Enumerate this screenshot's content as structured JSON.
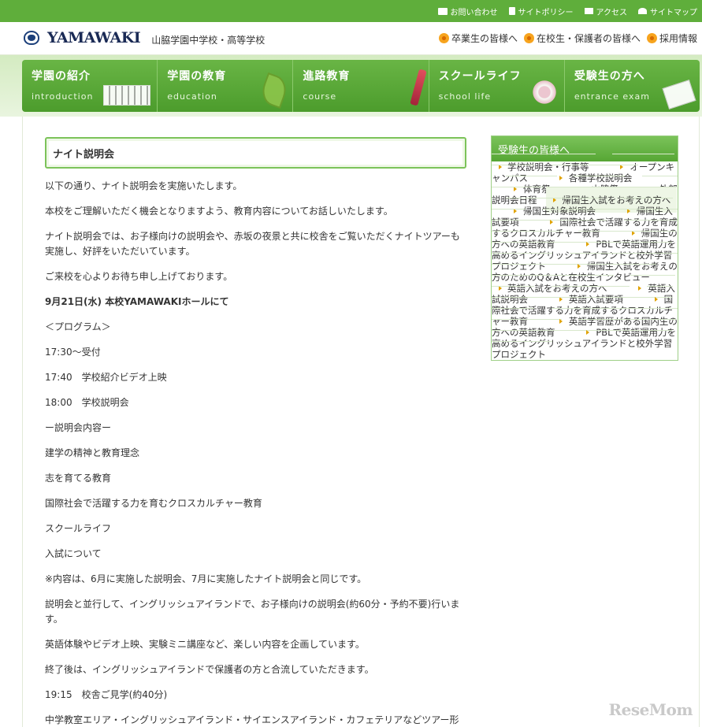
{
  "topbar": {
    "links": [
      {
        "label": "お問い合わせ",
        "icon": "mail-icon"
      },
      {
        "label": "サイトポリシー",
        "icon": "document-icon"
      },
      {
        "label": "アクセス",
        "icon": "building-icon"
      },
      {
        "label": "サイトマップ",
        "icon": "sitemap-icon"
      }
    ]
  },
  "header": {
    "logo": "YAMAWAKI",
    "school_name": "山脇学園中学校・高等学校",
    "links": [
      "卒業生の皆様へ",
      "在校生・保護者の皆様へ",
      "採用情報"
    ]
  },
  "nav": [
    {
      "jp": "学園の紹介",
      "en": "introduction",
      "pic": "school-building-image"
    },
    {
      "jp": "学園の教育",
      "en": "education",
      "pic": "leaf-image"
    },
    {
      "jp": "進路教育",
      "en": "course",
      "pic": "pen-image"
    },
    {
      "jp": "スクールライフ",
      "en": "school life",
      "pic": "flower-image"
    },
    {
      "jp": "受験生の方へ",
      "en": "entrance exam",
      "pic": "notebook-image"
    }
  ],
  "main": {
    "title": "ナイト説明会",
    "paragraphs": [
      "以下の通り、ナイト説明会を実施いたします。",
      "本校をご理解いただく機会となりますよう、教育内容についてお話しいたします。",
      "ナイト説明会では、お子様向けの説明会や、赤坂の夜景と共に校舎をご覧いただくナイトツアーも実施し、好評をいただいています。",
      "ご来校を心よりお待ち申し上げております。",
      "9月21日(水) 本校YAMAWAKIホールにて",
      "＜プログラム＞",
      "17:30～受付",
      "17:40　学校紹介ビデオ上映",
      "18:00　学校説明会",
      "ー説明会内容ー",
      "建学の精神と教育理念",
      "志を育てる教育",
      "国際社会で活躍する力を育むクロスカルチャー教育",
      "スクールライフ",
      "入試について",
      "※内容は、6月に実施した説明会、7月に実施したナイト説明会と同じです。",
      "説明会と並行して、イングリッシュアイランドで、お子様向けの説明会(約60分・予約不要)行います。",
      "英語体験やビデオ上映、実験ミニ講座など、楽しい内容を企画しています。",
      "終了後は、イングリッシュアイランドで保護者の方と合流していただきます。",
      "19:15　校舎ご見学(約40分)",
      "中学教室エリア・イングリッシュアイランド・サイエンスアイランド・カフェテリアなどツアー形式でご覧"
    ]
  },
  "sidebar": {
    "heading": "受験生の皆様へ",
    "items": [
      {
        "label": "学校説明会・行事等",
        "level": 1
      },
      {
        "label": "オープンキャンパス",
        "level": 2
      },
      {
        "label": "各種学校説明会",
        "level": 2
      },
      {
        "label": "体育祭",
        "level": 2
      },
      {
        "label": "山脇祭",
        "level": 2
      },
      {
        "label": "外部説明会日程",
        "level": 2
      },
      {
        "label": "帰国生入試をお考えの方へ",
        "level": 1
      },
      {
        "label": "帰国生対象説明会",
        "level": 2
      },
      {
        "label": "帰国生入試要項",
        "level": 2
      },
      {
        "label": "国際社会で活躍する力を育成するクロスカルチャー教育",
        "level": 2
      },
      {
        "label": "帰国生の方への英語教育",
        "level": 2
      },
      {
        "label": "PBLで英語運用力を高めるイングリッシュアイランドと校外学習プロジェクト",
        "level": 2
      },
      {
        "label": "帰国生入試をお考えの方のためのQ＆Aと在校生インタビュー",
        "level": 2
      },
      {
        "label": "英語入試をお考えの方へ",
        "level": 1
      },
      {
        "label": "英語入試説明会",
        "level": 2
      },
      {
        "label": "英語入試要項",
        "level": 2
      },
      {
        "label": "国際社会で活躍する力を育成するクロスカルチャー教育",
        "level": 2
      },
      {
        "label": "英語学習歴がある国内生の方への英語教育",
        "level": 2
      },
      {
        "label": "PBLで英語運用力を高めるイングリッシュアイランドと校外学習プロジェクト",
        "level": 2
      }
    ]
  },
  "watermark": "ReseMom"
}
